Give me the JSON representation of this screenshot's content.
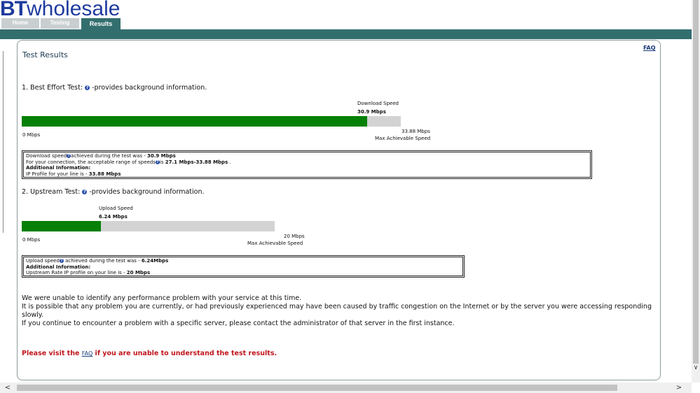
{
  "brand": {
    "logo_bt": "BT",
    "logo_rest": "wholesale",
    "color": "#1f3b9e"
  },
  "tabs": [
    {
      "label": "Home",
      "active": false
    },
    {
      "label": "Testing",
      "active": false
    },
    {
      "label": "Results",
      "active": true
    }
  ],
  "theme": {
    "header_bar": "#336e6e",
    "bar_fill": "#068006",
    "bar_track": "#d3d3d3",
    "alert_red": "#c0161c"
  },
  "faq_link": "FAQ",
  "page_title": "Test Results",
  "help_icon": {
    "glyph": "?",
    "name": "help-icon"
  },
  "download": {
    "section_prefix": "1. Best Effort Test:",
    "section_suffix": "-provides background information.",
    "label": "Download Speed",
    "value": "30.9 Mbps",
    "min_label": "0 Mbps",
    "max_value": "33.88 Mbps",
    "max_label": "Max Achievable Speed",
    "progress_fraction": 0.912,
    "info": {
      "line1_prefix": "Download speed",
      "line1_mid": "achieved during the test was - ",
      "line1_value": "30.9 Mbps",
      "line2_prefix": "For your connection, the acceptable range of speeds",
      "line2_mid": "is ",
      "line2_value": "27.1 Mbps-33.88 Mbps",
      "line2_suffix": " .",
      "line3": "Additional Information:",
      "line4_prefix": "IP Profile for your line is - ",
      "line4_value": "33.88 Mbps"
    }
  },
  "upload": {
    "section_prefix": "2. Upstream Test:",
    "section_suffix": "-provides background information.",
    "label": "Upload Speed",
    "value": "6.24 Mbps",
    "min_label": "0 Mbps",
    "max_value": "20 Mbps",
    "max_label": "Max Achievable Speed",
    "progress_fraction": 0.312,
    "info": {
      "line1_prefix": "Upload speed",
      "line1_mid": " achieved during the test was - ",
      "line1_value": "6.24Mbps",
      "line2": "Additional Information:",
      "line3_prefix": "Upstream Rate IP profile on your line is - ",
      "line3_value": "20 Mbps"
    }
  },
  "summary": [
    "We were unable to identify any performance problem with your service at this time.",
    "It is possible that any problem you are currently, or had previously experienced may have been caused by traffic congestion on the Internet or by the server you were accessing responding slowly.",
    "If you continue to encounter a problem with a specific server, please contact the administrator of that server in the first instance."
  ],
  "visit": {
    "prefix": "Please visit the ",
    "link": "FAQ",
    "suffix": " if you are unable to understand the test results."
  },
  "scroll": {
    "up": "∧",
    "down": "∨",
    "left": "<",
    "right": ">"
  }
}
